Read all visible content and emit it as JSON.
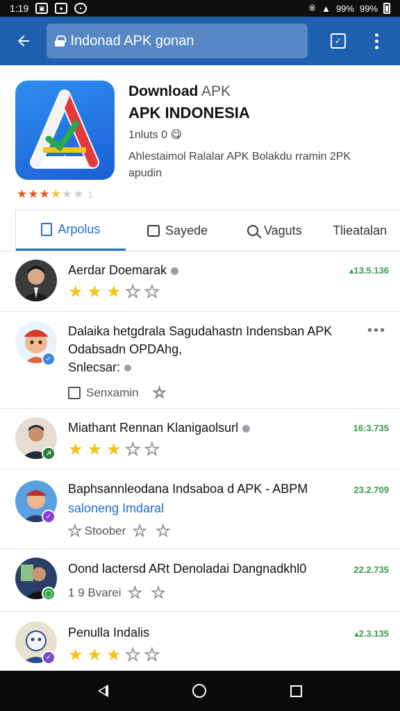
{
  "status_bar": {
    "time": "1:19",
    "icons_left": [
      "image-icon",
      "app-icon",
      "chat-icon"
    ],
    "signal": "99%",
    "battery": "99%"
  },
  "toolbar": {
    "back_icon": "arrow-left-icon",
    "url": "Indonad APK gonan",
    "tabs_icon": "tabs-icon",
    "menu_icon": "more-vert-icon"
  },
  "app": {
    "title_line1_bold": "Download",
    "title_line1_muted": " APK",
    "title_line2": "APK INDONESIA",
    "installs": "1nluts 0 😋",
    "description": "Ahlestaimol Ralalar APK Bolakdu rramin 2PK apudin",
    "rating_text": "★★★★☆☆ 1",
    "colors": {
      "accent": "#1f6fc8",
      "toolbar": "#1f5fb0",
      "date_green": "#3a9a4a"
    }
  },
  "tabs": [
    {
      "label": "Arpolus",
      "icon": "document-icon"
    },
    {
      "label": "Sayede",
      "icon": "chat-icon"
    },
    {
      "label": "Vaguts",
      "icon": "search-icon"
    },
    {
      "label": "Tlieatalan",
      "icon": ""
    }
  ],
  "reviews": [
    {
      "name": "Aerdar Doemarak",
      "date": "▴13.5.136",
      "stars_filled": 3,
      "stars_total": 5
    },
    {
      "name": "Dalaika hetgdrala Sagudahastn Indensban APK",
      "line2": "Odabsadn OPDAhg,",
      "line3": "Snlecsar:",
      "action_label": "Senxamin",
      "more": "•••"
    },
    {
      "name": "Miathant Rennan Klanigaolsurl",
      "date": "16:3.735",
      "stars_filled": 3,
      "stars_total": 5
    },
    {
      "name": "Baphsannleodana Indsaboa d APK - ABPM",
      "sub": "saloneng Imdaral",
      "date": "23.2.709",
      "stars_label": "Stoober"
    },
    {
      "name": "Oond lactersd ARt Denoladai Dangnadkhl0",
      "date": "22.2.735",
      "stars_label": "1 9 Bvarei"
    },
    {
      "name": "Penulla Indalis",
      "date": "▴2.3.135",
      "stars_filled": 3,
      "stars_total": 5
    }
  ]
}
